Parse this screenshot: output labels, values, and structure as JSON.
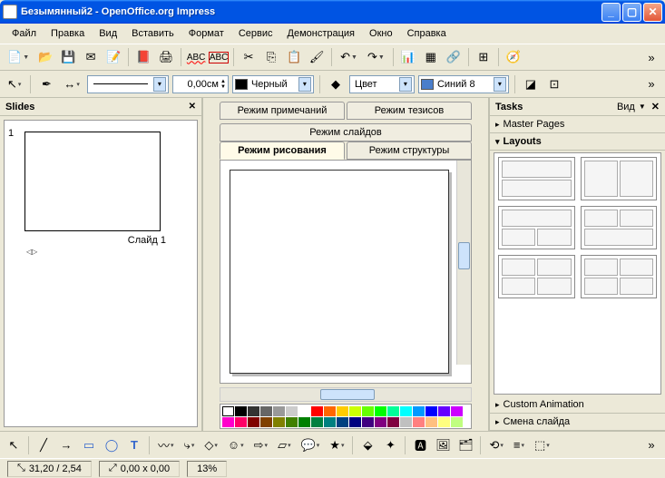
{
  "window": {
    "title": "Безымянный2 - OpenOffice.org Impress"
  },
  "menu": [
    "Файл",
    "Правка",
    "Вид",
    "Вставить",
    "Формат",
    "Сервис",
    "Демонстрация",
    "Окно",
    "Справка"
  ],
  "toolbar2": {
    "line_width": "0,00см",
    "line_color_label": "Черный",
    "fill_mode": "Цвет",
    "fill_color_label": "Синий 8",
    "colors": {
      "black": "#000000",
      "blue8": "#4a7ecb"
    }
  },
  "slides": {
    "title": "Slides",
    "items": [
      {
        "num": "1",
        "label": "Слайд 1"
      }
    ]
  },
  "center_tabs": {
    "row1": [
      "Режим примечаний",
      "Режим тезисов"
    ],
    "row1b": "Режим слайдов",
    "row2": [
      "Режим рисования",
      "Режим структуры"
    ],
    "active": "Режим рисования"
  },
  "tasks": {
    "title": "Tasks",
    "view_label": "Вид",
    "sections": {
      "master": "Master Pages",
      "layouts": "Layouts",
      "custom_anim": "Custom Animation",
      "slide_change": "Смена слайда"
    }
  },
  "palette": [
    "#000000",
    "#333333",
    "#666666",
    "#999999",
    "#cccccc",
    "#ffffff",
    "#ff0000",
    "#ff6600",
    "#ffcc00",
    "#ccff00",
    "#66ff00",
    "#00ff00",
    "#00ff99",
    "#00ffff",
    "#0099ff",
    "#0000ff",
    "#6600ff",
    "#cc00ff",
    "#ff00cc",
    "#ff0066",
    "#800000",
    "#804000",
    "#808000",
    "#408000",
    "#008000",
    "#008040",
    "#008080",
    "#004080",
    "#000080",
    "#400080",
    "#800080",
    "#800040",
    "#c0c0c0",
    "#ff8080",
    "#ffc080",
    "#ffff80",
    "#c0ff80",
    "#80ff80",
    "#80ffc0",
    "#80ffff",
    "#80c0ff",
    "#8080ff",
    "#c080ff",
    "#ff80ff",
    "#ff80c0"
  ],
  "status": {
    "pos": "31,20 / 2,54",
    "size": "0,00 x 0,00",
    "zoom": "13%"
  }
}
